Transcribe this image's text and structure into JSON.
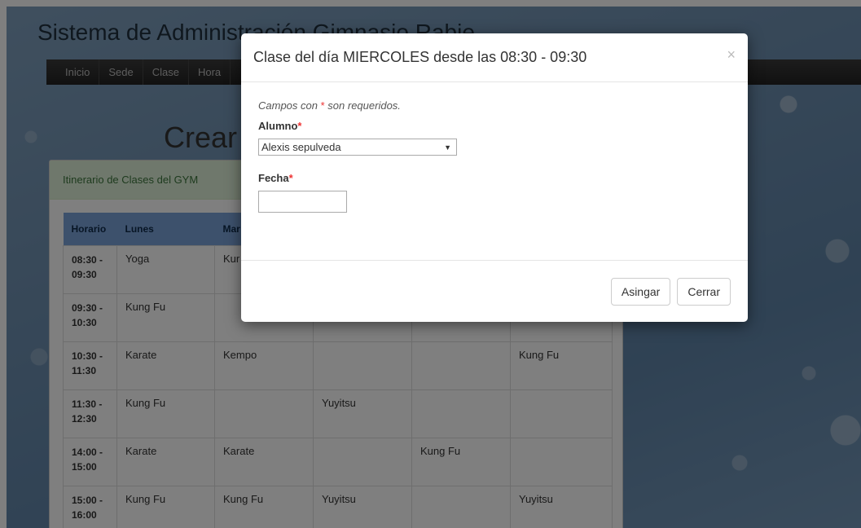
{
  "site": {
    "title": "Sistema de Administración Gimnasio Rabie"
  },
  "nav": {
    "items": [
      "Inicio",
      "Sede",
      "Clase",
      "Hora"
    ]
  },
  "page": {
    "heading": "Crear"
  },
  "panel": {
    "heading": "Itinerario de Clases del GYM"
  },
  "schedule": {
    "headers": [
      "Horario",
      "Lunes",
      "Mar",
      "",
      "",
      ""
    ],
    "rows": [
      [
        "08:30 - 09:30",
        "Yoga",
        "Kur",
        "",
        "",
        ""
      ],
      [
        "09:30 - 10:30",
        "Kung Fu",
        "",
        "",
        "",
        ""
      ],
      [
        "10:30 - 11:30",
        "Karate",
        "Kempo",
        "",
        "",
        "Kung Fu"
      ],
      [
        "11:30 - 12:30",
        "Kung Fu",
        "",
        "Yuyitsu",
        "",
        ""
      ],
      [
        "14:00 - 15:00",
        "Karate",
        "Karate",
        "",
        "Kung Fu",
        ""
      ],
      [
        "15:00 - 16:00",
        "Kung Fu",
        "Kung Fu",
        "Yuyitsu",
        "",
        "Yuyitsu"
      ]
    ]
  },
  "modal": {
    "title": "Clase del día MIERCOLES desde las 08:30 - 09:30",
    "close_symbol": "×",
    "required_note_prefix": "Campos con",
    "required_star": "*",
    "required_note_suffix": "son requeridos.",
    "alumno_label": "Alumno",
    "alumno_value": "Alexis sepulveda",
    "fecha_label": "Fecha",
    "fecha_value": "",
    "assign_label": "Asingar",
    "close_label": "Cerrar"
  },
  "icons": {
    "close": "close-icon",
    "dropdown": "chevron-down-icon"
  }
}
